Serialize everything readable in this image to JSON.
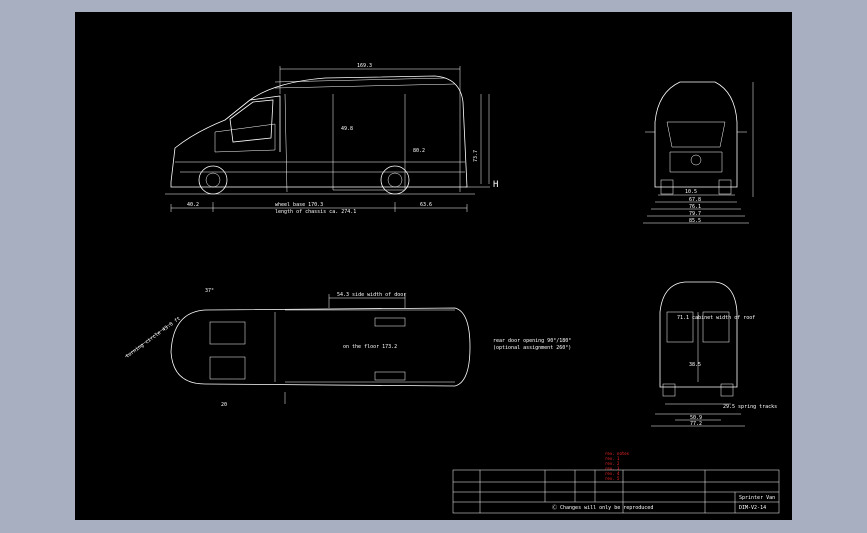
{
  "drawing": {
    "background": "#000000",
    "line_color": "#ffffff",
    "side_view": {
      "overall_top_dim": "169.3",
      "wheelbase_label": "wheel base 170.3",
      "chassis_length_label": "length of chassis ca. 274.1",
      "front_overhang": "40.2",
      "rear_overhang": "63.6",
      "cargo_height": "73.7",
      "floor_length": "80.2",
      "door_dim": "49.8",
      "H_marker": "H"
    },
    "top_view": {
      "step_label": "54.3 side width of door",
      "floor_label": "on the floor 173.2",
      "rear_door_note": "rear door opening 90°/180°",
      "rear_door_note2": "(optional assignment 260°)",
      "angle": "37°",
      "rear_dim": "20",
      "turning_label": "turning circle 43.8 ft"
    },
    "front_view": {
      "dims": [
        "67.8",
        "76.1",
        "79.7",
        "85.5"
      ],
      "inner_dim": "10.5"
    },
    "rear_view": {
      "dims": [
        "50.9",
        "77.2"
      ],
      "top_label": "71.1 cabinet width of roof",
      "spring_label": "29.5 spring tracks",
      "inner_dim": "38.5"
    },
    "red_notes": [
      "rev. notes",
      "rev. 1",
      "rev. 2",
      "rev. 3",
      "rev. 4",
      "rev. 5"
    ],
    "title_block": {
      "note_text": "Ⓒ Changes will only be reproduced",
      "title_name": "Sprinter Van",
      "drawing_no": "DIM-V2-14"
    }
  }
}
